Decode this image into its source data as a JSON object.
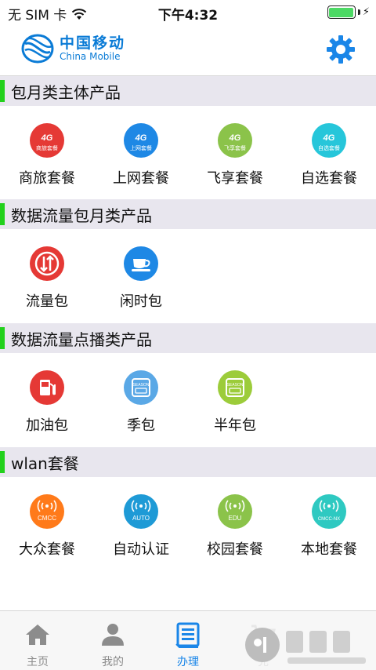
{
  "status_bar": {
    "carrier": "无 SIM 卡",
    "time": "下午4:32"
  },
  "header": {
    "logo_cn": "中国移动",
    "logo_en": "China Mobile"
  },
  "sections": [
    {
      "title": "包月类主体产品",
      "items": [
        {
          "label": "商旅套餐",
          "icon": "4g-business-icon",
          "badge": "4G",
          "sub": "商旅套餐",
          "color": "#e53935"
        },
        {
          "label": "上网套餐",
          "icon": "4g-internet-icon",
          "badge": "4G",
          "sub": "上网套餐",
          "color": "#1e88e5"
        },
        {
          "label": "飞享套餐",
          "icon": "4g-feixiang-icon",
          "badge": "4G",
          "sub": "飞享套餐",
          "color": "#8bc34a"
        },
        {
          "label": "自选套餐",
          "icon": "4g-custom-icon",
          "badge": "4G",
          "sub": "自选套餐",
          "color": "#26c6da"
        }
      ]
    },
    {
      "title": "数据流量包月类产品",
      "items": [
        {
          "label": "流量包",
          "icon": "data-arrows-icon",
          "color": "#e53935"
        },
        {
          "label": "闲时包",
          "icon": "coffee-cup-icon",
          "color": "#1e88e5"
        }
      ]
    },
    {
      "title": "数据流量点播类产品",
      "items": [
        {
          "label": "加油包",
          "icon": "fuel-pump-icon",
          "color": "#e53935"
        },
        {
          "label": "季包",
          "icon": "season-card-icon",
          "sub": "SEASON",
          "color": "#5aa8e6"
        },
        {
          "label": "半年包",
          "icon": "season-half-icon",
          "sub": "SEASON",
          "color": "#9ccc3a"
        }
      ]
    },
    {
      "title": "wlan套餐",
      "items": [
        {
          "label": "大众套餐",
          "icon": "wifi-cmcc-icon",
          "sub": "CMCC",
          "color": "#ff7a1a"
        },
        {
          "label": "自动认证",
          "icon": "wifi-auto-icon",
          "sub": "AUTO",
          "color": "#1e9ad6"
        },
        {
          "label": "校园套餐",
          "icon": "wifi-edu-icon",
          "sub": "EDU",
          "color": "#8bc34a"
        },
        {
          "label": "本地套餐",
          "icon": "wifi-local-icon",
          "sub": "CMCC-NX",
          "color": "#2ec9c1"
        }
      ]
    }
  ],
  "tabs": [
    {
      "label": "主页",
      "icon": "home-icon",
      "active": false
    },
    {
      "label": "我的",
      "icon": "person-icon",
      "active": false
    },
    {
      "label": "办理",
      "icon": "list-icon",
      "active": true
    },
    {
      "label": "充",
      "icon": "cart-icon",
      "active": false
    }
  ],
  "colors": {
    "accent": "#1a86e8",
    "section_bar": "#22d11c",
    "section_bg": "#e8e6ee"
  }
}
